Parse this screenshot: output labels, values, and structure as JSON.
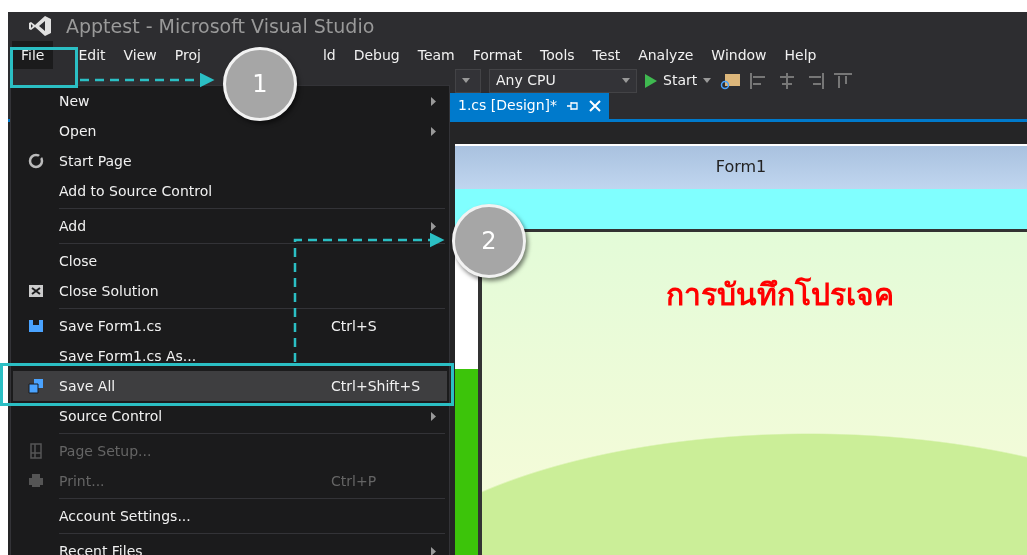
{
  "window": {
    "title": "Apptest - Microsoft Visual Studio"
  },
  "menu_bar": [
    {
      "label": "File",
      "selected": true
    },
    {
      "label": "Edit",
      "selected": false
    },
    {
      "label": "View",
      "selected": false
    },
    {
      "label": "Proj",
      "selected": false
    },
    {
      "label": "ld",
      "selected": false
    },
    {
      "label": "Debug",
      "selected": false
    },
    {
      "label": "Team",
      "selected": false
    },
    {
      "label": "Format",
      "selected": false
    },
    {
      "label": "Tools",
      "selected": false
    },
    {
      "label": "Test",
      "selected": false
    },
    {
      "label": "Analyze",
      "selected": false
    },
    {
      "label": "Window",
      "selected": false
    },
    {
      "label": "Help",
      "selected": false
    }
  ],
  "toolbar": {
    "platform": "Any CPU",
    "start_button": "Start"
  },
  "document_tab": {
    "label": "1.cs [Design]*",
    "selected": true
  },
  "form": {
    "title": "Form1",
    "heading": "การบันทึกโปรเจค"
  },
  "file_menu": {
    "groups": [
      {
        "items": [
          {
            "label": "New",
            "submenu": true,
            "disabled": false,
            "selected": false
          },
          {
            "label": "Open",
            "submenu": true,
            "disabled": false,
            "selected": false
          },
          {
            "label": "Start Page",
            "submenu": false,
            "disabled": false,
            "selected": false
          },
          {
            "label": "Add to Source Control",
            "submenu": false,
            "disabled": false,
            "selected": false
          }
        ]
      },
      {
        "items": [
          {
            "label": "Add",
            "submenu": true,
            "disabled": false,
            "selected": false
          }
        ]
      },
      {
        "items": [
          {
            "label": "Close",
            "submenu": false,
            "disabled": false,
            "selected": false
          },
          {
            "label": "Close Solution",
            "submenu": false,
            "disabled": false,
            "selected": false
          }
        ]
      },
      {
        "items": [
          {
            "label": "Save Form1.cs",
            "shortcut": "Ctrl+S",
            "submenu": false,
            "disabled": false,
            "selected": false
          },
          {
            "label": "Save Form1.cs As...",
            "submenu": false,
            "disabled": false,
            "selected": false
          },
          {
            "label": "Save All",
            "shortcut": "Ctrl+Shift+S",
            "submenu": false,
            "disabled": false,
            "selected": true
          },
          {
            "label": "Source Control",
            "submenu": true,
            "disabled": false,
            "selected": false
          }
        ]
      },
      {
        "items": [
          {
            "label": "Page Setup...",
            "submenu": false,
            "disabled": true,
            "selected": false
          },
          {
            "label": "Print...",
            "shortcut": "Ctrl+P",
            "submenu": false,
            "disabled": true,
            "selected": false
          }
        ]
      },
      {
        "items": [
          {
            "label": "Account Settings...",
            "submenu": false,
            "disabled": false,
            "selected": false
          }
        ]
      },
      {
        "items": [
          {
            "label": "Recent Files",
            "submenu": true,
            "disabled": false,
            "selected": false
          }
        ]
      }
    ]
  },
  "callouts": [
    {
      "number": "1"
    },
    {
      "number": "2"
    }
  ]
}
